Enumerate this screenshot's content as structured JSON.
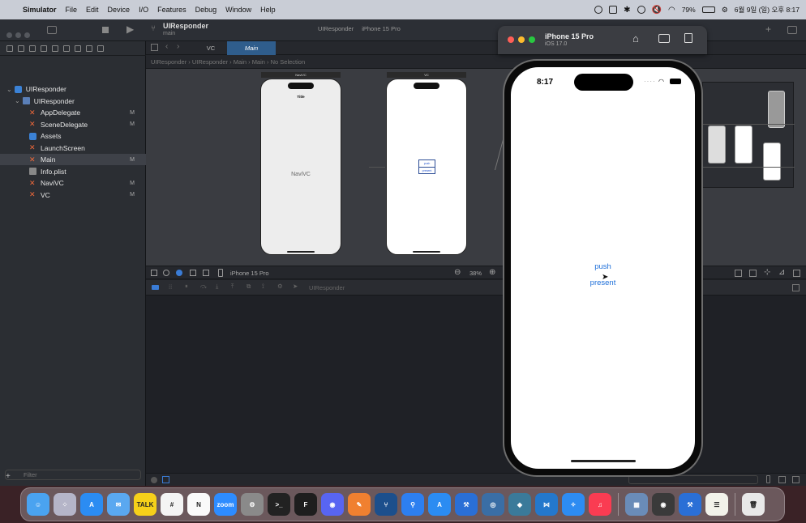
{
  "menubar": {
    "app_name": "Simulator",
    "items": [
      "File",
      "Edit",
      "Device",
      "I/O",
      "Features",
      "Debug",
      "Window",
      "Help"
    ],
    "battery": "79%",
    "datetime": "6월 9일 (일) 오후 8:17"
  },
  "xcode": {
    "project_name": "UIResponder",
    "branch": "main",
    "scheme": "UIResponder",
    "destination": "iPhone 15 Pro",
    "tabs": [
      "VC",
      "Main"
    ],
    "jumpbar": [
      "UIResponder",
      "UIResponder",
      "Main",
      "Main",
      "No Selection"
    ],
    "tree": [
      {
        "label": "UIResponder",
        "kind": "project",
        "mod": ""
      },
      {
        "label": "UIResponder",
        "kind": "folder",
        "mod": ""
      },
      {
        "label": "AppDelegate",
        "kind": "swift",
        "mod": "M"
      },
      {
        "label": "SceneDelegate",
        "kind": "swift",
        "mod": "M"
      },
      {
        "label": "Assets",
        "kind": "assets",
        "mod": ""
      },
      {
        "label": "LaunchScreen",
        "kind": "storyboard",
        "mod": ""
      },
      {
        "label": "Main",
        "kind": "storyboard",
        "mod": "M"
      },
      {
        "label": "Info.plist",
        "kind": "plist",
        "mod": ""
      },
      {
        "label": "NaviVC",
        "kind": "swift",
        "mod": "M"
      },
      {
        "label": "VC",
        "kind": "swift",
        "mod": "M"
      }
    ],
    "filter_placeholder": "Filter",
    "canvas": {
      "scene1_header": "NaviVC",
      "scene1_title": "Title",
      "scene1_label": "NaviVC",
      "scene2_header": "VC",
      "scene2_btn1": "push",
      "scene2_btn2": "present",
      "device": "iPhone 15 Pro",
      "zoom": "38%"
    },
    "debug_target": "UIResponder"
  },
  "simulator": {
    "device_name": "iPhone 15 Pro",
    "os": "iOS 17.0",
    "time": "8:17",
    "buttons": [
      "push",
      "present"
    ]
  },
  "dock": {
    "apps": [
      "Finder",
      "Launchpad",
      "App Store",
      "Mail",
      "KakaoTalk",
      "Slack",
      "Notion",
      "Zoom",
      "System Settings",
      "Terminal",
      "Figma",
      "Discord",
      "Pencil",
      "Fork",
      "Maps",
      "App Store",
      "Xcode",
      "Python",
      "Vanta",
      "Visual Studio Code",
      "Safari",
      "Music",
      "Preview",
      "Quicktime",
      "Xcode",
      "TextEdit",
      "Trash"
    ]
  }
}
